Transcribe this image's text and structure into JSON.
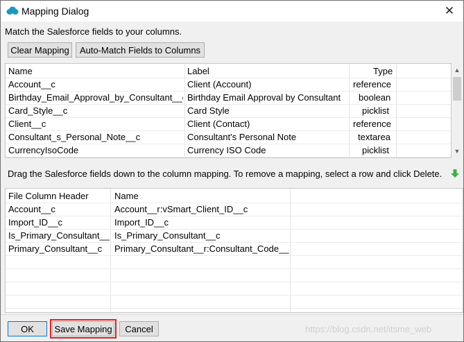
{
  "window": {
    "title": "Mapping Dialog",
    "close_glyph": "✕"
  },
  "instruction": "Match the Salesforce fields to your columns.",
  "buttons": {
    "clear_mapping": "Clear Mapping",
    "auto_match": "Auto-Match Fields to Columns",
    "ok": "OK",
    "save_mapping": "Save Mapping",
    "cancel": "Cancel"
  },
  "fields_table": {
    "headers": {
      "name": "Name",
      "label": "Label",
      "type": "Type"
    },
    "rows": [
      {
        "name": "Account__c",
        "label": "Client (Account)",
        "type": "reference"
      },
      {
        "name": "Birthday_Email_Approval_by_Consultant__c",
        "label": "Birthday Email Approval by Consultant",
        "type": "boolean"
      },
      {
        "name": "Card_Style__c",
        "label": "Card Style",
        "type": "picklist"
      },
      {
        "name": "Client__c",
        "label": "Client (Contact)",
        "type": "reference"
      },
      {
        "name": "Consultant_s_Personal_Note__c",
        "label": "Consultant's Personal Note",
        "type": "textarea"
      },
      {
        "name": "CurrencyIsoCode",
        "label": "Currency ISO Code",
        "type": "picklist"
      }
    ]
  },
  "drag_instruction": "Drag the Salesforce fields down to the column mapping.  To remove a mapping, select a row and click Delete.",
  "mapping_table": {
    "headers": {
      "file_column": "File Column Header",
      "name": "Name"
    },
    "rows": [
      {
        "file_column": "Account__c",
        "name": "Account__r:vSmart_Client_ID__c"
      },
      {
        "file_column": "Import_ID__c",
        "name": "Import_ID__c"
      },
      {
        "file_column": "Is_Primary_Consultant__c",
        "name": "Is_Primary_Consultant__c"
      },
      {
        "file_column": "Primary_Consultant__c",
        "name": "Primary_Consultant__r:Consultant_Code__c"
      }
    ]
  },
  "watermark": "https://blog.csdn.net/itsme_web",
  "colors": {
    "salesforce_blue": "#1798c1",
    "highlight_red": "#e02020",
    "arrow_green": "#3cb043"
  },
  "icons": {
    "title": "salesforce-cloud-icon",
    "drag": "green-down-arrow-icon"
  }
}
